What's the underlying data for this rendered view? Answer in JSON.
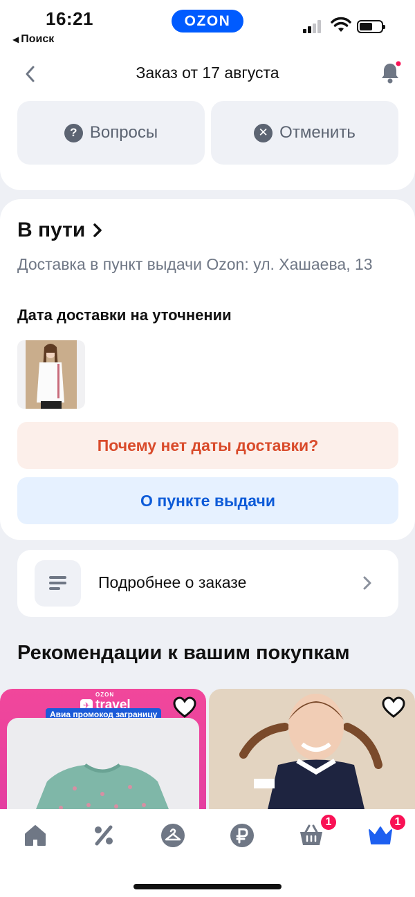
{
  "status_bar": {
    "time": "16:21",
    "back_app": "Поиск",
    "brand": "OZON"
  },
  "header": {
    "title": "Заказ от 17 августа"
  },
  "actions": {
    "questions_label": "Вопросы",
    "cancel_label": "Отменить"
  },
  "shipment": {
    "status": "В пути",
    "address": "Доставка в пункт выдачи Ozon: ул. Хашаева, 13",
    "date_note": "Дата доставки на уточнении",
    "why_no_date_label": "Почему нет даты доставки?",
    "pickup_info_label": "О пункте выдачи"
  },
  "details": {
    "label": "Подробнее о заказе"
  },
  "recommendations": {
    "title": "Рекомендации к вашим покупкам",
    "card1": {
      "brand_small": "OZON",
      "brand": "travel",
      "promo": "Авиа промокод заграницу"
    }
  },
  "tabbar": {
    "items": [
      {
        "name": "home-icon"
      },
      {
        "name": "percent-icon"
      },
      {
        "name": "hanger-icon"
      },
      {
        "name": "ruble-icon"
      },
      {
        "name": "cart-icon",
        "badge": "1"
      },
      {
        "name": "crown-icon",
        "badge": "1"
      }
    ]
  },
  "colors": {
    "brand": "#005bff",
    "warn_text": "#d94b2b",
    "info_text": "#0d5bd8",
    "badge": "#f91155"
  }
}
